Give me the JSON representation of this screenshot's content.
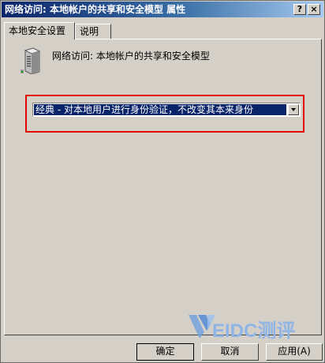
{
  "window": {
    "title": "网络访问: 本地帐户的共享和安全模型 属性",
    "help_glyph": "?",
    "close_glyph": "×"
  },
  "tabs": [
    {
      "label": "本地安全设置",
      "active": true
    },
    {
      "label": "说明",
      "active": false
    }
  ],
  "policy": {
    "icon": "server-policy-icon",
    "name": "网络访问: 本地帐户的共享和安全模型"
  },
  "dropdown": {
    "selected": "经典 - 对本地用户进行身份验证，不改变其本来身份",
    "highlight_color": "#e30000"
  },
  "buttons": {
    "ok": "确定",
    "cancel": "取消",
    "apply": "应用(A)"
  },
  "watermark": {
    "text": "EIDC测评"
  }
}
